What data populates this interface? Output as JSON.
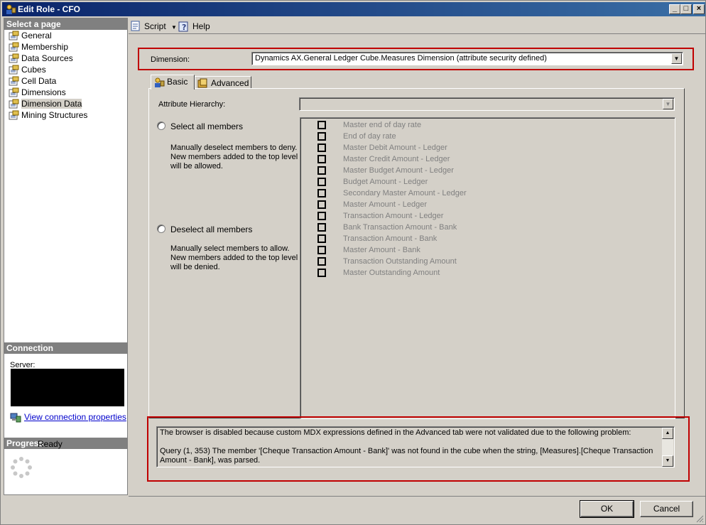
{
  "window": {
    "title": "Edit Role - CFO"
  },
  "left_panel": {
    "select_page_header": "Select a page",
    "pages": [
      {
        "label": "General"
      },
      {
        "label": "Membership"
      },
      {
        "label": "Data Sources"
      },
      {
        "label": "Cubes"
      },
      {
        "label": "Cell Data"
      },
      {
        "label": "Dimensions"
      },
      {
        "label": "Dimension Data",
        "selected": true
      },
      {
        "label": "Mining Structures"
      }
    ],
    "connection_header": "Connection",
    "server_label": "Server:",
    "view_connection_link": "View connection properties",
    "progress_header": "Progress",
    "progress_status": "Ready"
  },
  "toolbar": {
    "script_label": "Script",
    "help_label": "Help"
  },
  "dimension": {
    "label": "Dimension:",
    "value": "Dynamics AX.General Ledger Cube.Measures Dimension (attribute security defined)"
  },
  "tabs": {
    "basic": "Basic",
    "advanced": "Advanced"
  },
  "basic": {
    "hierarchy_label": "Attribute Hierarchy:",
    "hierarchy_value": "",
    "select_all_label": "Select all members",
    "select_all_desc": "Manually deselect members to deny. New members added to the top level will be allowed.",
    "deselect_all_label": "Deselect all members",
    "deselect_all_desc": "Manually select members to allow. New members added to the top level will be denied.",
    "members": [
      "Master end of day rate",
      "End of day rate",
      "Master Debit Amount - Ledger",
      "Master Credit Amount - Ledger",
      "Master Budget Amount - Ledger",
      "Budget Amount - Ledger",
      "Secondary Master Amount - Ledger",
      "Master Amount - Ledger",
      "Transaction Amount - Ledger",
      "Bank Transaction Amount - Bank",
      "Transaction Amount - Bank",
      "Master Amount - Bank",
      "Transaction Outstanding Amount",
      "Master Outstanding Amount"
    ]
  },
  "message": {
    "text": "The browser is disabled because custom MDX expressions defined in the Advanced tab were not validated due to the following problem:\n\nQuery (1, 353) The member '[Cheque Transaction Amount - Bank]' was not found in the cube when the string, [Measures].[Cheque Transaction Amount - Bank], was parsed."
  },
  "buttons": {
    "ok": "OK",
    "cancel": "Cancel"
  },
  "colors": {
    "title_bar": "#0a246a",
    "highlight_border": "#c00000",
    "link": "#0000cc"
  }
}
